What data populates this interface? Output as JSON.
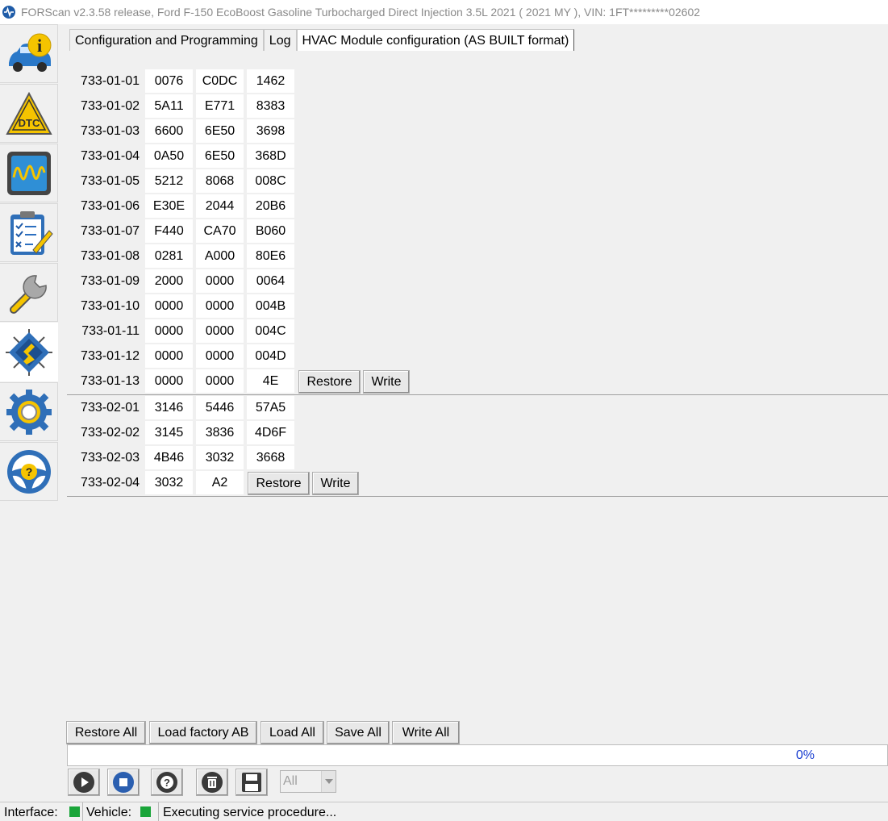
{
  "window": {
    "title": "FORScan v2.3.58 release, Ford F-150 EcoBoost Gasoline Turbocharged Direct Injection 3.5L 2021 ( 2021 MY ), VIN: 1FT*********02602"
  },
  "sidebar": {
    "items": [
      {
        "name": "vehicle-info",
        "icon": "car-info-icon"
      },
      {
        "name": "dtc",
        "icon": "dtc-warning-icon"
      },
      {
        "name": "oscilloscope",
        "icon": "oscilloscope-icon"
      },
      {
        "name": "tests",
        "icon": "checklist-icon"
      },
      {
        "name": "service",
        "icon": "wrench-icon"
      },
      {
        "name": "configuration",
        "icon": "chip-icon",
        "active": true
      },
      {
        "name": "settings",
        "icon": "gear-icon"
      },
      {
        "name": "help",
        "icon": "steering-help-icon"
      }
    ]
  },
  "tabs": [
    {
      "label": "Configuration and Programming"
    },
    {
      "label": "Log"
    },
    {
      "label": "HVAC Module configuration (AS BUILT format)",
      "active": true
    }
  ],
  "blocks": [
    {
      "rows": [
        {
          "id": "733-01-01",
          "values": [
            "0076",
            "C0DC",
            "1462"
          ]
        },
        {
          "id": "733-01-02",
          "values": [
            "5A11",
            "E771",
            "8383"
          ]
        },
        {
          "id": "733-01-03",
          "values": [
            "6600",
            "6E50",
            "3698"
          ]
        },
        {
          "id": "733-01-04",
          "values": [
            "0A50",
            "6E50",
            "368D"
          ]
        },
        {
          "id": "733-01-05",
          "values": [
            "5212",
            "8068",
            "008C"
          ]
        },
        {
          "id": "733-01-06",
          "values": [
            "E30E",
            "2044",
            "20B6"
          ]
        },
        {
          "id": "733-01-07",
          "values": [
            "F440",
            "CA70",
            "B060"
          ]
        },
        {
          "id": "733-01-08",
          "values": [
            "0281",
            "A000",
            "80E6"
          ]
        },
        {
          "id": "733-01-09",
          "values": [
            "2000",
            "0000",
            "0064"
          ]
        },
        {
          "id": "733-01-10",
          "values": [
            "0000",
            "0000",
            "004B"
          ]
        },
        {
          "id": "733-01-11",
          "values": [
            "0000",
            "0000",
            "004C"
          ]
        },
        {
          "id": "733-01-12",
          "values": [
            "0000",
            "0000",
            "004D"
          ]
        },
        {
          "id": "733-01-13",
          "values": [
            "0000",
            "0000",
            "4E"
          ],
          "restore": "Restore",
          "write": "Write"
        }
      ]
    },
    {
      "rows": [
        {
          "id": "733-02-01",
          "values": [
            "3146",
            "5446",
            "57A5"
          ]
        },
        {
          "id": "733-02-02",
          "values": [
            "3145",
            "3836",
            "4D6F"
          ]
        },
        {
          "id": "733-02-03",
          "values": [
            "4B46",
            "3032",
            "3668"
          ]
        },
        {
          "id": "733-02-04",
          "values": [
            "3032",
            "A2"
          ],
          "restore": "Restore",
          "write": "Write"
        }
      ]
    }
  ],
  "actions": {
    "restore_all": "Restore All",
    "load_factory": "Load factory AB",
    "load_all": "Load All",
    "save_all": "Save All",
    "write_all": "Write All"
  },
  "progress": {
    "percent_label": "0%",
    "value": 0
  },
  "toolbar": {
    "buttons": [
      "play-icon",
      "stop-icon",
      "help-lifebuoy-icon",
      "clear-log-icon",
      "save-disk-icon"
    ],
    "filter_value": "All"
  },
  "status": {
    "interface_label": "Interface:",
    "vehicle_label": "Vehicle:",
    "message": "Executing service procedure...",
    "indicator_color": "#1aa53a"
  }
}
